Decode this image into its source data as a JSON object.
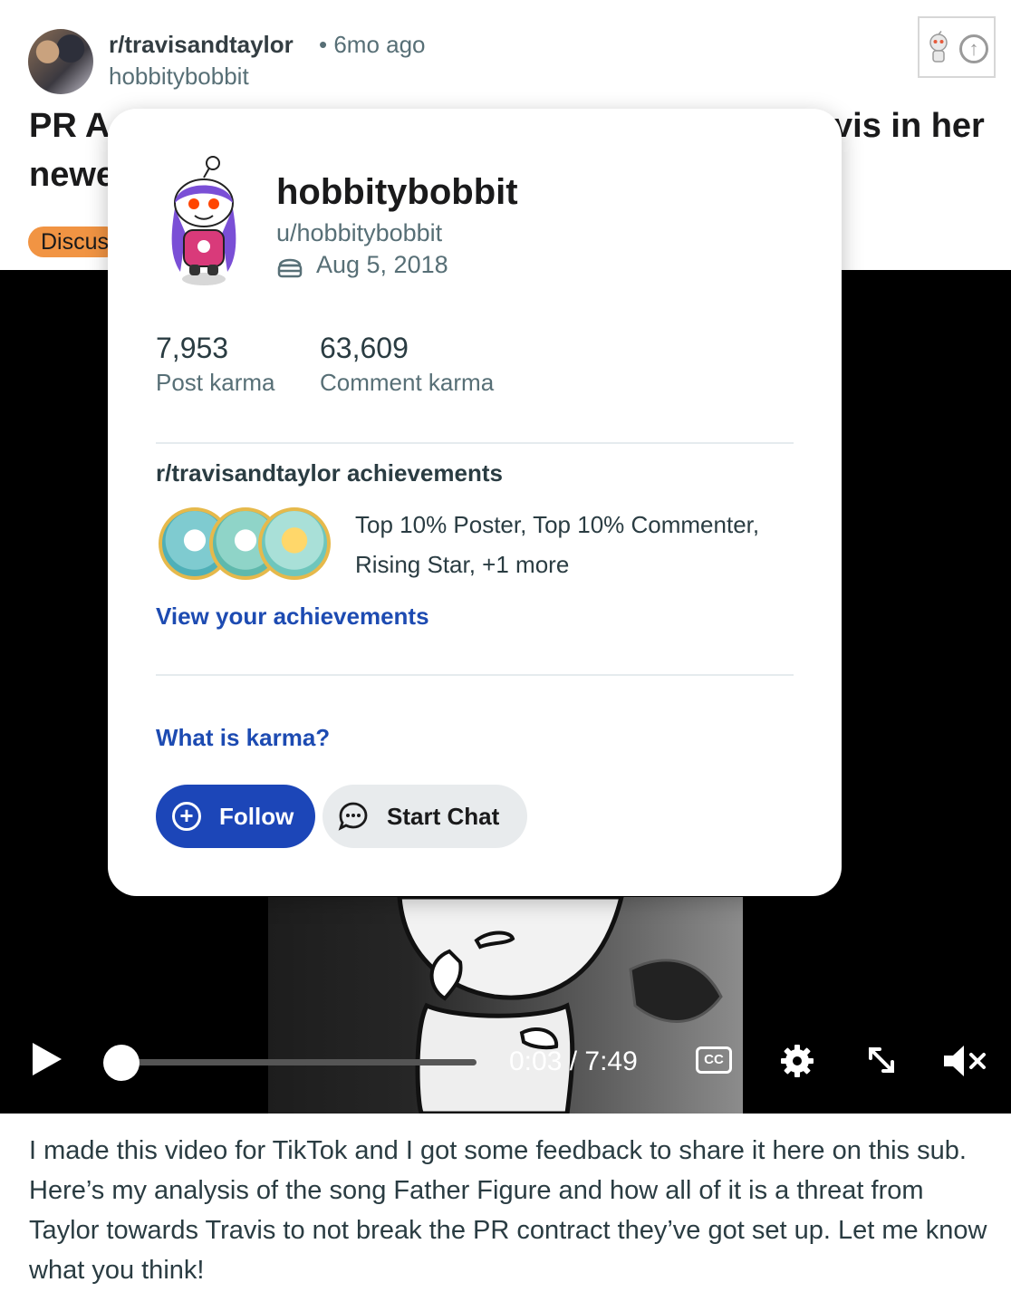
{
  "post": {
    "subreddit": "r/travisandtaylor",
    "time": "• 6mo ago",
    "author": "hobbitybobbit",
    "title_visible_left_line1": "PR A",
    "title_visible_right_line1": "vis in her",
    "title_visible_left_line2": "newe",
    "flair": "Discus",
    "body": "I made this video for TikTok and I got some feedback to share it here on this sub. Here’s my analysis of the song Father Figure and how all of it is a threat from Taylor towards Travis to not break the PR contract they’ve got set up. Let me know what you think!"
  },
  "video": {
    "time_display": "0:03 / 7:49",
    "cc_label": "CC",
    "progress_fraction": 0.006
  },
  "profile_card": {
    "display_name": "hobbitybobbit",
    "username": "u/hobbitybobbit",
    "cake_day": "Aug 5, 2018",
    "post_karma": "7,953",
    "post_karma_label": "Post karma",
    "comment_karma": "63,609",
    "comment_karma_label": "Comment karma",
    "achievements_title": "r/travisandtaylor achievements",
    "achievements_text": "Top 10% Poster, Top 10% Commenter, Rising Star, +1 more",
    "view_achievements": "View your achievements",
    "what_is_karma": "What is karma?",
    "follow_label": "Follow",
    "chat_label": "Start Chat"
  },
  "colors": {
    "accent_blue": "#1c46b8",
    "link_blue": "#1d4bb2",
    "flair_orange": "#f19443"
  }
}
